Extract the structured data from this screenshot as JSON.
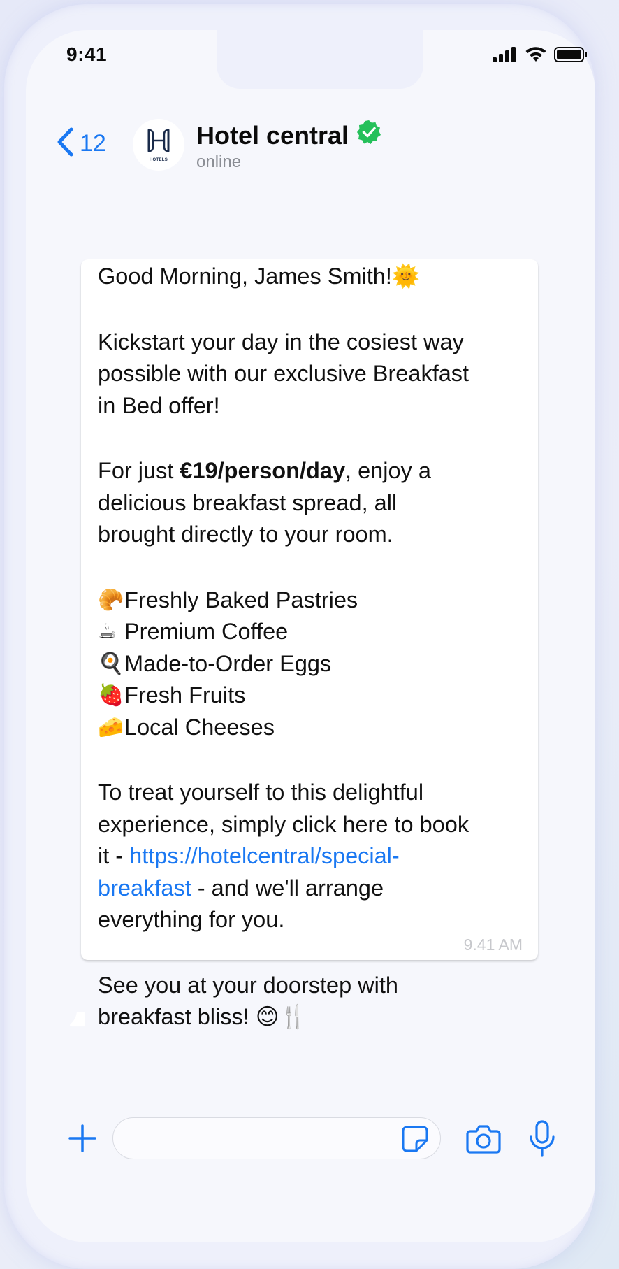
{
  "status_bar": {
    "time": "9:41",
    "icons": [
      "cellular-signal-icon",
      "wifi-icon",
      "battery-icon"
    ]
  },
  "header": {
    "back_count": "12",
    "back_icon": "chevron-left-icon",
    "avatar_label": "HOTELS",
    "contact_name": "Hotel central",
    "verified_icon": "verified-badge-icon",
    "contact_status": "online"
  },
  "message": {
    "greeting": "Good Morning, James Smith!",
    "greeting_emoji": "🌞",
    "intro_1": "Kickstart your day in the cosiest way",
    "intro_2": "possible with our exclusive Breakfast",
    "intro_3": "in Bed offer!",
    "price_prefix": "For just ",
    "price_bold": "€19/person/day",
    "price_suffix": ", enjoy a",
    "price_2": "delicious breakfast spread, all",
    "price_3": "brought directly to your room.",
    "items": [
      {
        "emoji": "🥐",
        "label": "Freshly Baked Pastries"
      },
      {
        "emoji": "☕",
        "label": "Premium Coffee"
      },
      {
        "emoji": "🍳",
        "label": "Made-to-Order Eggs"
      },
      {
        "emoji": "🍓",
        "label": "Fresh Fruits"
      },
      {
        "emoji": "🧀",
        "label": "Local Cheeses"
      }
    ],
    "cta_1": "To treat yourself to this delightful",
    "cta_2": "experience, simply click here to book",
    "cta_3_prefix": "it - ",
    "cta_link_part1": "https://hotelcentral/special-",
    "cta_link_part2": "breakfast",
    "cta_4_suffix": " - and we'll arrange",
    "cta_5": "everything for you.",
    "closing_1": "See you at your doorstep with",
    "closing_2": "breakfast bliss! ",
    "closing_emoji": "😊🍴",
    "time": "9.41 AM"
  },
  "input_bar": {
    "placeholder": "",
    "value": ""
  },
  "colors": {
    "accent": "#1a78f2",
    "verified": "#25c05a",
    "bubble": "#ffffff",
    "screen_bg": "#f6f7fc"
  }
}
